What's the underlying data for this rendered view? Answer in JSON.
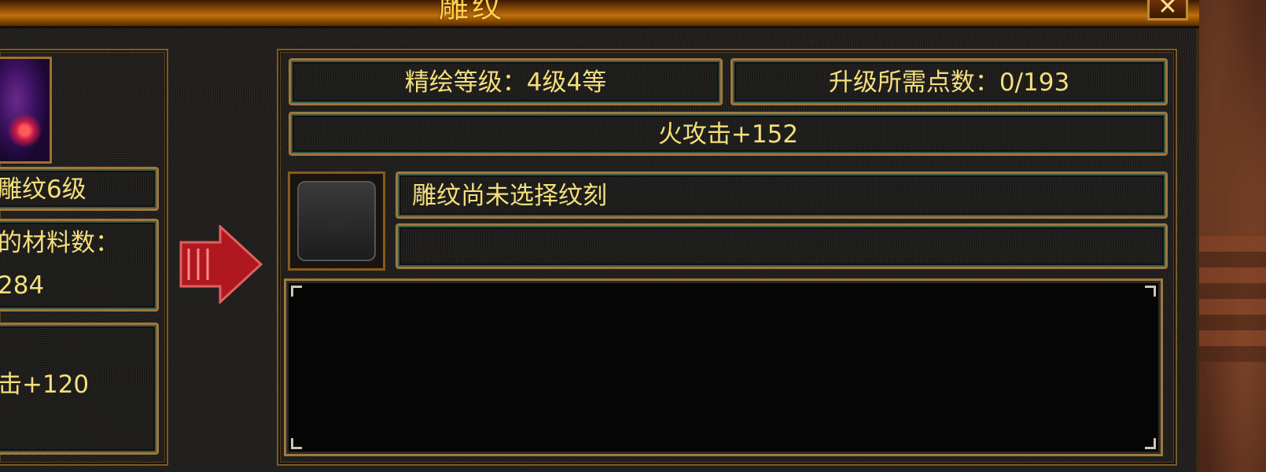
{
  "window": {
    "title": "雕纹",
    "close_icon": "close-icon"
  },
  "left_panel": {
    "item_level": "雕纹6级",
    "materials_label": "的材料数：",
    "materials_value": "284",
    "bonus": "击+120"
  },
  "right_panel": {
    "refine_level": "精绘等级：4级4等",
    "upgrade_points": "升级所需点数：0/193",
    "attribute": "火攻击+152",
    "engrave_status": "雕纹尚未选择纹刻",
    "engrave_detail": "",
    "description": ""
  },
  "icons": {
    "item": "item-icon",
    "slot": "engrave-slot-icon",
    "arrow": "red-arrow-icon"
  },
  "colors": {
    "text": "#f5df7a",
    "border": "#a0783a",
    "title": "#ffd24a"
  }
}
